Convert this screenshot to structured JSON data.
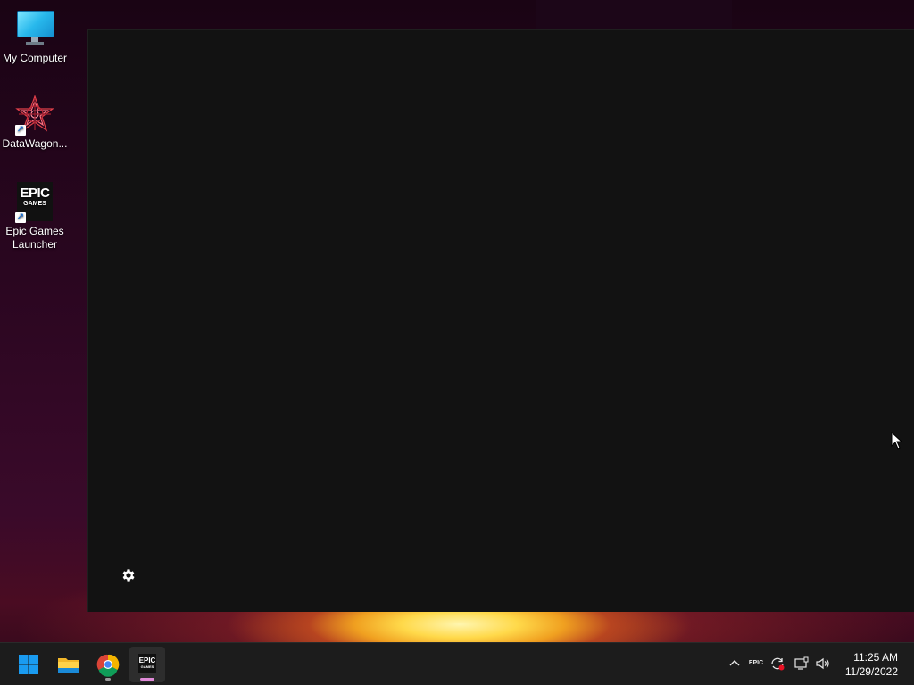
{
  "desktop": {
    "icons": [
      {
        "label": "My Computer",
        "icon": "monitor-icon"
      },
      {
        "label": "DataWagon...",
        "icon": "datawagon-icon"
      },
      {
        "label_line1": "Epic Games",
        "label_line2": "Launcher",
        "icon": "epic-games-icon",
        "tile_line1": "EPIC",
        "tile_line2": "GAMES"
      }
    ]
  },
  "app_window": {
    "settings_icon": "gear-icon"
  },
  "taskbar": {
    "apps": [
      {
        "name": "Start",
        "icon": "windows-start-icon"
      },
      {
        "name": "File Explorer",
        "icon": "folder-icon"
      },
      {
        "name": "Google Chrome",
        "icon": "chrome-icon"
      },
      {
        "name": "Epic Games Launcher",
        "icon": "epic-games-icon",
        "tile_line1": "EPIC",
        "tile_line2": "GAMES"
      }
    ],
    "tray": {
      "icons": [
        "chevron-up-icon",
        "epic-tray-icon",
        "sync-icon",
        "network-icon",
        "volume-icon"
      ],
      "epic_text": "EPIC"
    },
    "clock": {
      "time": "11:25 AM",
      "date": "11/29/2022"
    }
  },
  "colors": {
    "accent_blue": "#0a84d8",
    "window_bg": "#121212",
    "taskbar_bg": "#1c1c1c",
    "active_indicator": "#e08ad8"
  }
}
